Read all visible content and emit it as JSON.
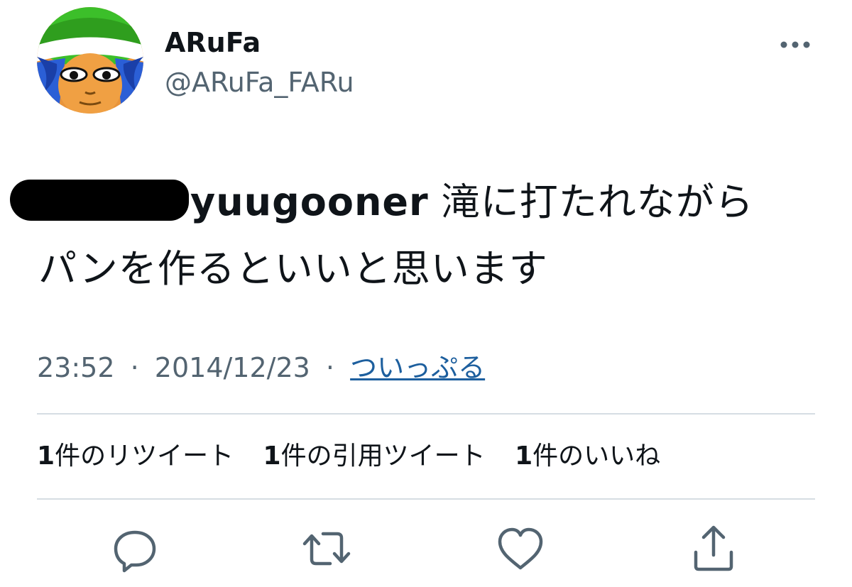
{
  "tweet": {
    "author": {
      "display_name": "ARuFa",
      "handle": "@ARuFa_FARu",
      "avatar_icon": "avatar-illustration"
    },
    "more_icon": "more-horizontal-icon",
    "text": {
      "mention": "yuugooner",
      "line1_rest": " 滝に打たれながら",
      "line2": "パンを作るといいと思います"
    },
    "meta": {
      "time": "23:52",
      "separator": "·",
      "date": "2014/12/23",
      "source": "ついっぷる"
    },
    "stats": {
      "retweets": {
        "count": "1",
        "label": "件のリツイート"
      },
      "quotes": {
        "count": "1",
        "label": "件の引用ツイート"
      },
      "likes": {
        "count": "1",
        "label": "件のいいね"
      }
    },
    "actions": [
      "reply-icon",
      "retweet-icon",
      "like-icon",
      "share-icon"
    ],
    "colors": {
      "text": "#0f1419",
      "secondary": "#536471",
      "link": "#1d5f9e",
      "divider": "#d6dde3"
    }
  }
}
